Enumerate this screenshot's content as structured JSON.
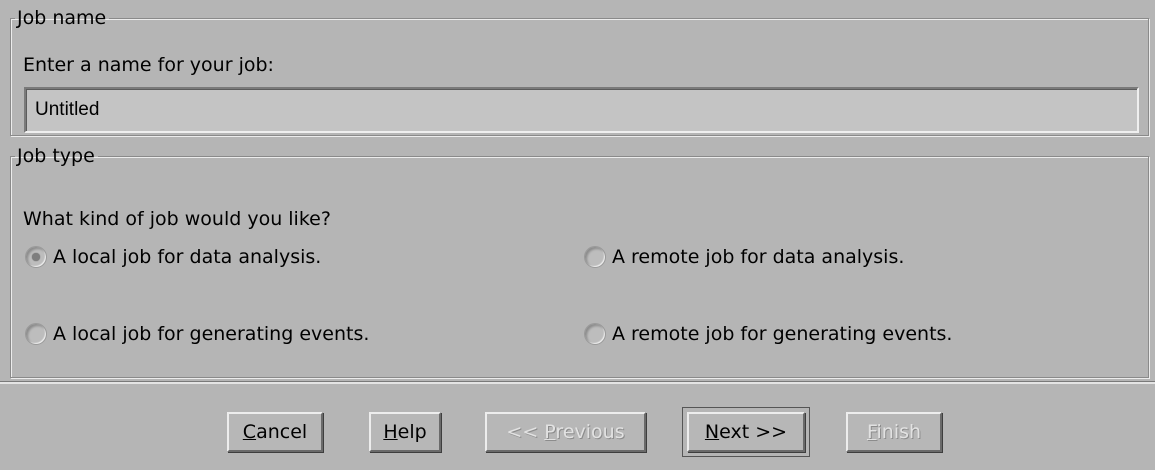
{
  "job_name_group": {
    "title": "Job name",
    "prompt": "Enter a name for your job:",
    "value": "Untitled"
  },
  "job_type_group": {
    "title": "Job type",
    "prompt": "What kind of job would you like?",
    "options": [
      {
        "label": "A local job for data analysis.",
        "selected": true
      },
      {
        "label": "A remote job for data analysis.",
        "selected": false
      },
      {
        "label": "A local job for generating events.",
        "selected": false
      },
      {
        "label": "A remote job for generating events.",
        "selected": false
      }
    ]
  },
  "buttons": {
    "cancel": {
      "mnemonic": "C",
      "rest": "ancel",
      "enabled": true
    },
    "help": {
      "mnemonic": "H",
      "rest": "elp",
      "enabled": true
    },
    "previous": {
      "prefix": "<< ",
      "mnemonic": "P",
      "rest": "revious",
      "enabled": false
    },
    "next": {
      "mnemonic": "N",
      "rest": "ext >>",
      "enabled": true,
      "default": true
    },
    "finish": {
      "mnemonic": "F",
      "rest": "inish",
      "enabled": false
    }
  },
  "colors": {
    "background": "#b5b5b5",
    "disabled_text": "#e2e2e2"
  }
}
